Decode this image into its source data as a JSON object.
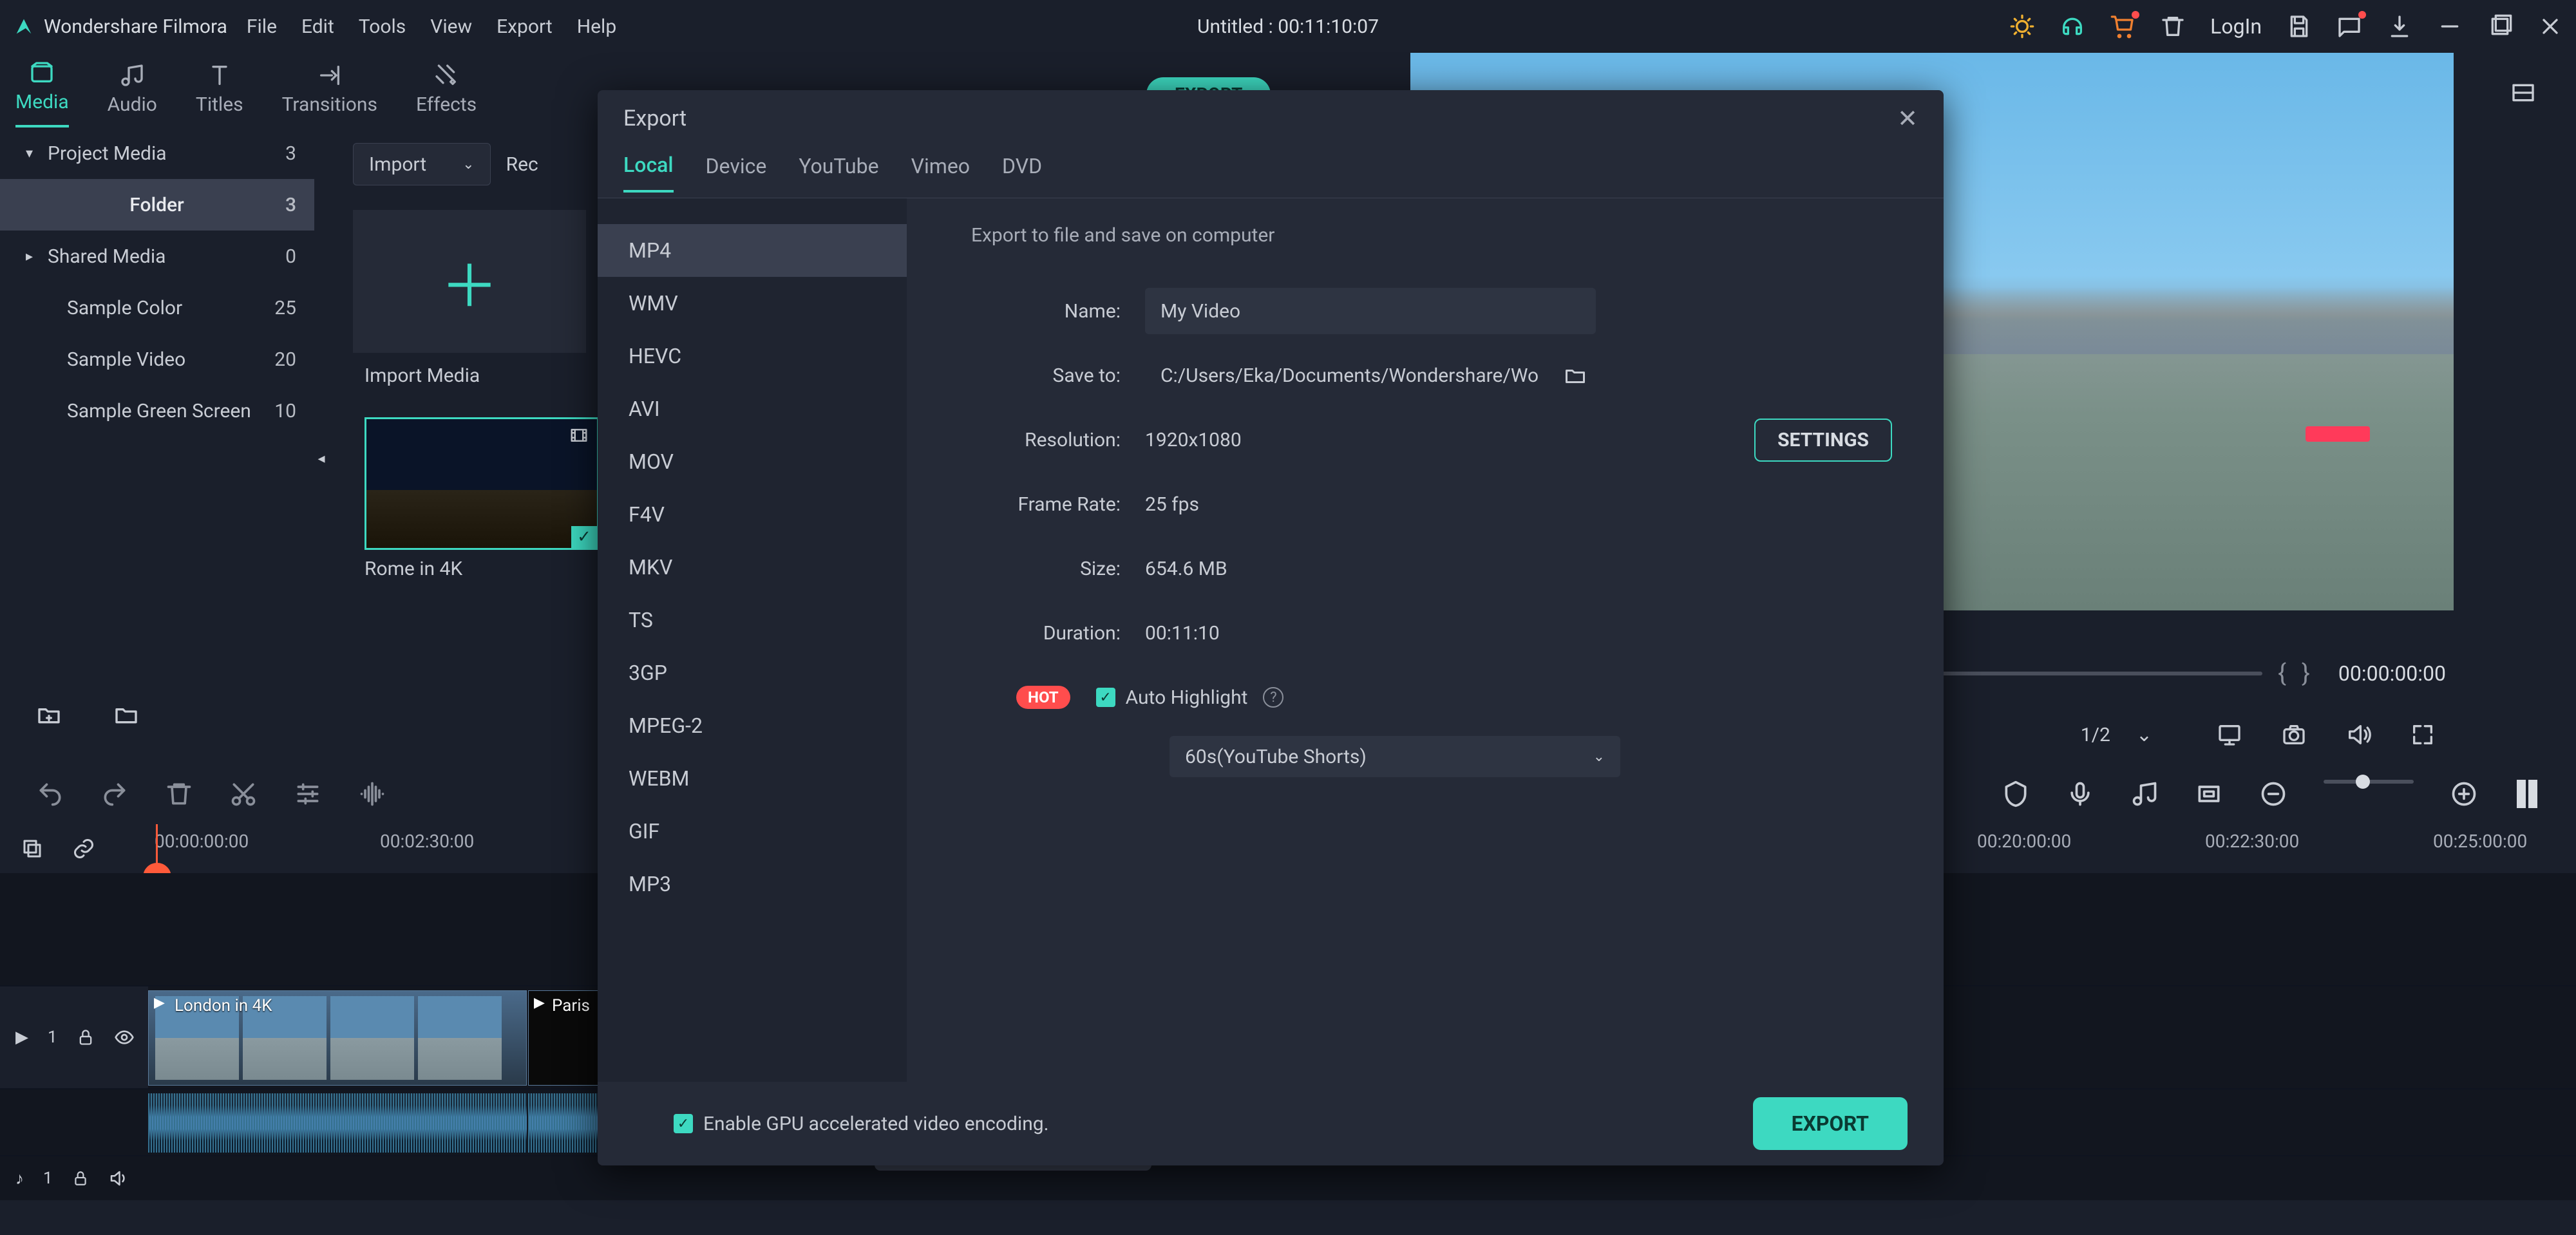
{
  "app_name": "Wondershare Filmora",
  "menu": [
    "File",
    "Edit",
    "Tools",
    "View",
    "Export",
    "Help"
  ],
  "doc_title": "Untitled : 00:11:10:07",
  "login": "LogIn",
  "modes": [
    {
      "label": "Media",
      "active": true
    },
    {
      "label": "Audio",
      "active": false
    },
    {
      "label": "Titles",
      "active": false
    },
    {
      "label": "Transitions",
      "active": false
    },
    {
      "label": "Effects",
      "active": false
    }
  ],
  "main_export_label": "EXPORT",
  "sidebar": {
    "items": [
      {
        "label": "Project Media",
        "count": "3",
        "header": true
      },
      {
        "label": "Folder",
        "count": "3",
        "selected": true
      },
      {
        "label": "Shared Media",
        "count": "0",
        "header": true
      },
      {
        "label": "Sample Color",
        "count": "25"
      },
      {
        "label": "Sample Video",
        "count": "20"
      },
      {
        "label": "Sample Green Screen",
        "count": "10"
      }
    ]
  },
  "media_toolbar": {
    "import": "Import",
    "record": "Rec"
  },
  "import_tile": "Import Media",
  "clip": {
    "name": "Rome in 4K"
  },
  "timeline": {
    "ruler": [
      "00:00:00:00",
      "00:02:30:00",
      "00:20:00:00",
      "00:22:30:00",
      "00:25:00:00"
    ],
    "clips": [
      {
        "label": "London in 4K"
      },
      {
        "label": "Paris"
      }
    ],
    "video_track": "1",
    "audio_track": "1"
  },
  "preview": {
    "pager": "1/2",
    "timecode": "00:00:00:00"
  },
  "export_dialog": {
    "title": "Export",
    "tabs": [
      {
        "label": "Local",
        "active": true
      },
      {
        "label": "Device",
        "active": false
      },
      {
        "label": "YouTube",
        "active": false
      },
      {
        "label": "Vimeo",
        "active": false
      },
      {
        "label": "DVD",
        "active": false
      }
    ],
    "formats": [
      "MP4",
      "WMV",
      "HEVC",
      "AVI",
      "MOV",
      "F4V",
      "MKV",
      "TS",
      "3GP",
      "MPEG-2",
      "WEBM",
      "GIF",
      "MP3"
    ],
    "active_format": "MP4",
    "hint": "Export to file and save on computer",
    "fields": {
      "name_label": "Name:",
      "name_value": "My Video",
      "saveto_label": "Save to:",
      "saveto_value": "C:/Users/Eka/Documents/Wondershare/Wo",
      "resolution_label": "Resolution:",
      "resolution_value": "1920x1080",
      "settings_btn": "SETTINGS",
      "framerate_label": "Frame Rate:",
      "framerate_value": "25 fps",
      "size_label": "Size:",
      "size_value": "654.6 MB",
      "duration_label": "Duration:",
      "duration_value": "00:11:10",
      "hot": "HOT",
      "auto_highlight": "Auto Highlight",
      "preset": "60s(YouTube Shorts)"
    },
    "gpu": "Enable GPU accelerated video encoding.",
    "export_btn": "EXPORT"
  }
}
